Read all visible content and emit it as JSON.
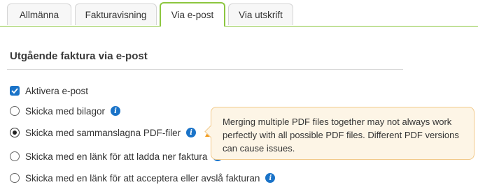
{
  "tabs": [
    {
      "label": "Allmänna",
      "active": false
    },
    {
      "label": "Fakturavisning",
      "active": false
    },
    {
      "label": "Via e-post",
      "active": true
    },
    {
      "label": "Via utskrift",
      "active": false
    }
  ],
  "section": {
    "title": "Utgående faktura via e-post"
  },
  "options": {
    "activate_email": {
      "label": "Aktivera e-post",
      "checked": true
    },
    "send_with_attachments": {
      "label": "Skicka med bilagor",
      "selected": false
    },
    "send_merged_pdf": {
      "label": "Skicka med sammanslagna PDF-filer",
      "selected": true
    },
    "send_download_link": {
      "label": "Skicka med en länk för att ladda ner faktura",
      "selected": false
    },
    "send_accept_link": {
      "label": "Skicka med en länk för att acceptera eller avslå fakturan",
      "selected": false
    }
  },
  "tooltip": {
    "text": "Merging multiple PDF files together may not always work perfectly with all possible PDF files. Different PDF versions can cause issues."
  },
  "colors": {
    "accent_green": "#8cc63f",
    "primary_blue": "#1a73c8",
    "warning_orange": "#f29a1b",
    "tooltip_bg": "#fdf5e6"
  },
  "icons": {
    "info": "info-icon",
    "warning": "warning-icon",
    "check": "checkmark-icon"
  }
}
